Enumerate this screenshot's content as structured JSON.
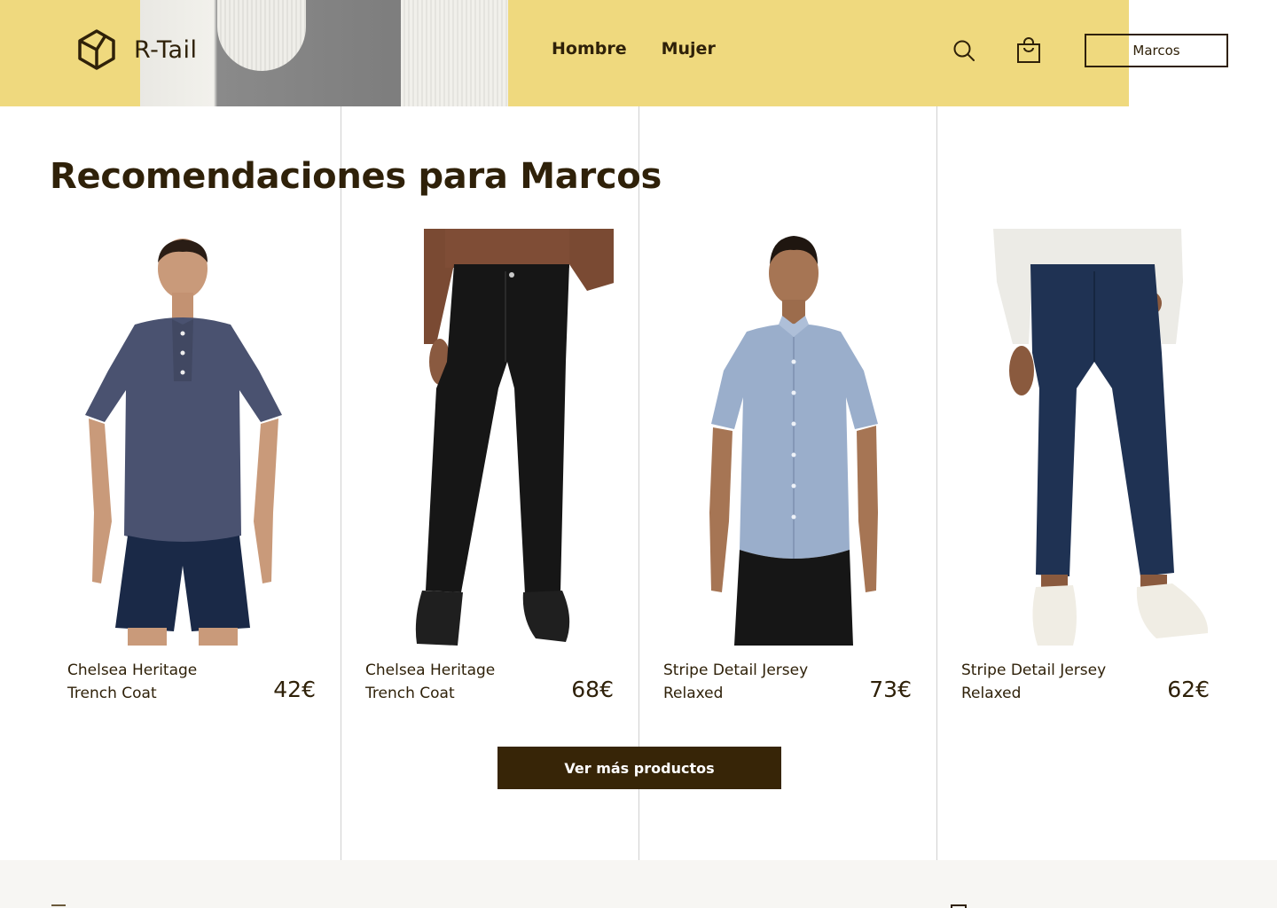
{
  "brand": {
    "name": "R-Tail"
  },
  "nav": [
    {
      "label": "Hombre"
    },
    {
      "label": "Mujer"
    }
  ],
  "header": {
    "user_label": "Marcos"
  },
  "section": {
    "title": "Recomendaciones para Marcos"
  },
  "products": [
    {
      "name": "Chelsea Heritage Trench Coat",
      "price": "42€",
      "image": "navy-henley-tshirt-and-shorts"
    },
    {
      "name": "Chelsea Heritage Trench Coat",
      "price": "68€",
      "image": "black-corduroy-pants"
    },
    {
      "name": "Stripe Detail Jersey Relaxed",
      "price": "73€",
      "image": "light-blue-linen-shirt"
    },
    {
      "name": "Stripe Detail Jersey Relaxed",
      "price": "62€",
      "image": "navy-chino-pants"
    }
  ],
  "cta": {
    "label": "Ver más productos"
  },
  "colors": {
    "accent_yellow": "#efd97e",
    "brand_dark": "#372507",
    "text": "#2f2109",
    "footer_bg": "#f7f6f3"
  }
}
